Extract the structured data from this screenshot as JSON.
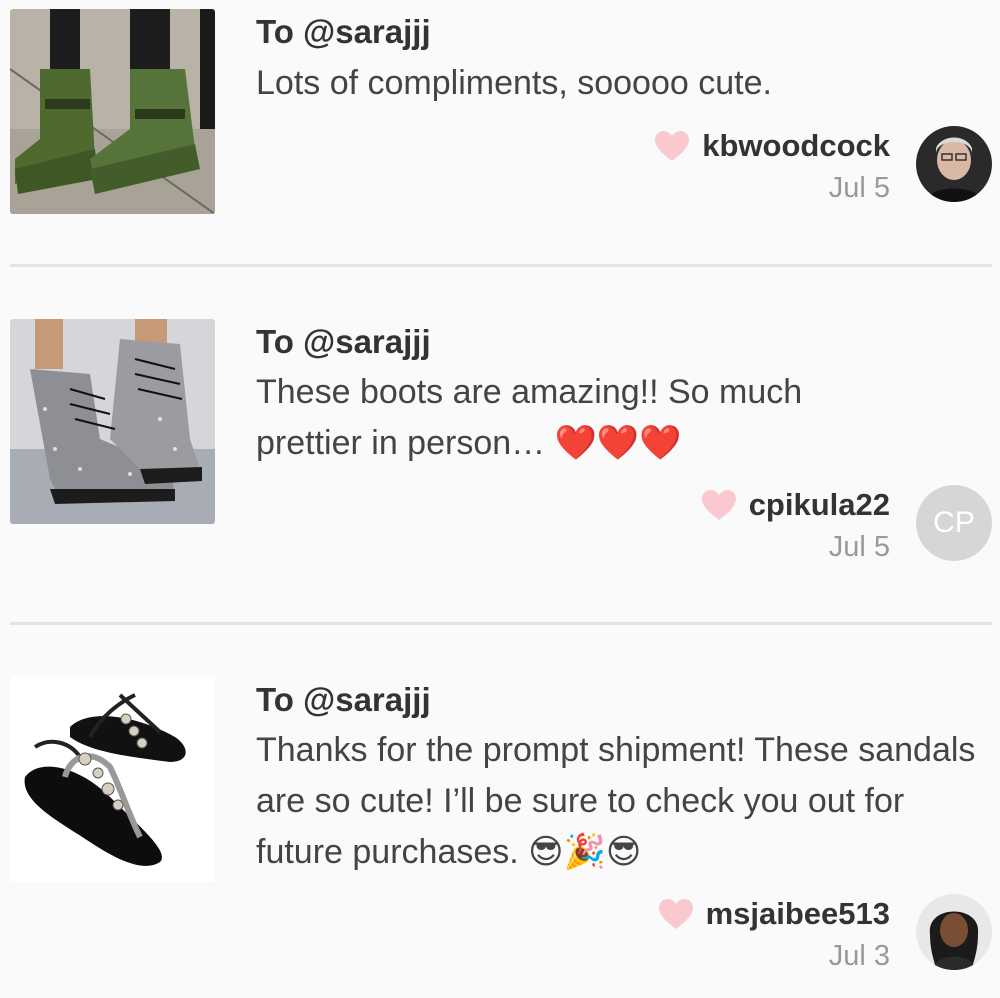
{
  "reviews": [
    {
      "to": "To @sarajjj",
      "body": "Lots of compliments, sooooo cute.",
      "emoji": "",
      "username": "kbwoodcock",
      "date": "Jul 5",
      "avatar_initials": ""
    },
    {
      "to": "To @sarajjj",
      "body": "These boots are amazing!! So much prettier in person…",
      "emoji": "❤️❤️❤️",
      "username": "cpikula22",
      "date": "Jul 5",
      "avatar_initials": "CP"
    },
    {
      "to": "To @sarajjj",
      "body": "Thanks for the prompt shipment! These sandals are so cute! I’ll be sure to check you out for future purchases.",
      "emoji": "😎🎉😎",
      "username": "msjaibee513",
      "date": "Jul 3",
      "avatar_initials": ""
    }
  ],
  "colors": {
    "heart": "#f9c9cf",
    "divider": "#e4e4e4",
    "date": "#9a9a9a",
    "avatar_initials_bg": "#d6d6d6"
  }
}
